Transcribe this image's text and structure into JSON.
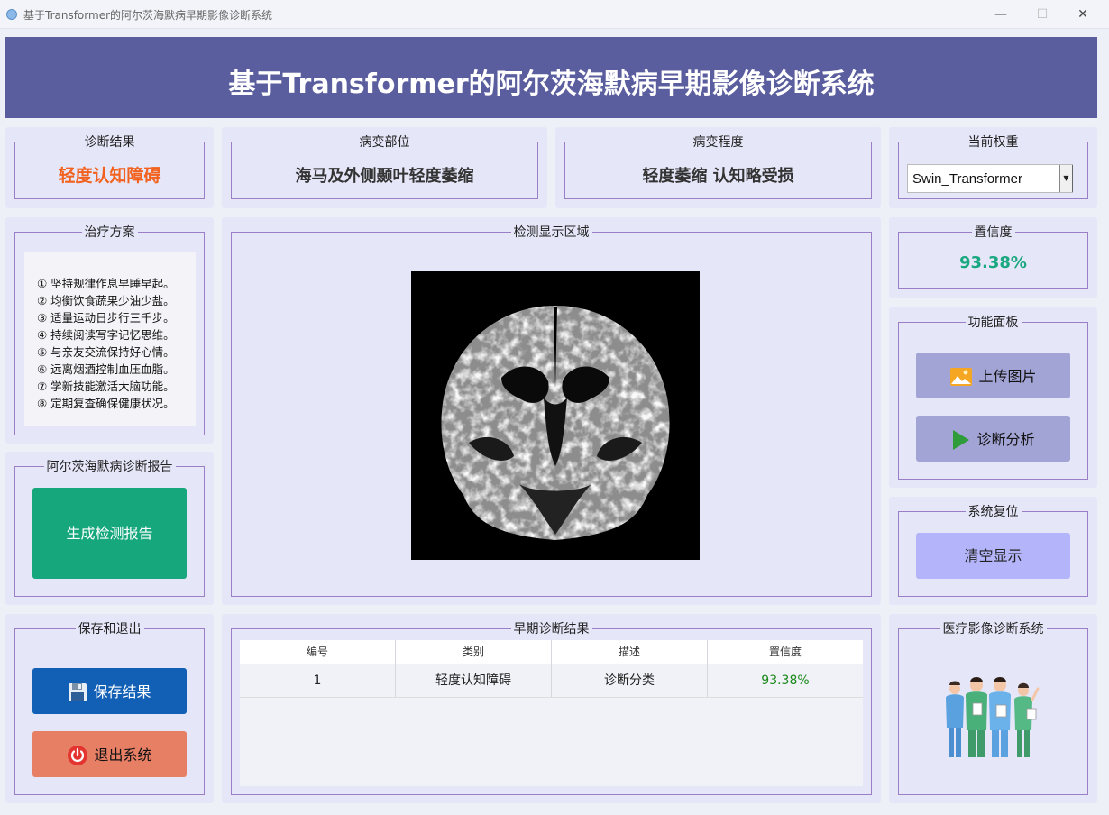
{
  "window": {
    "title": "基于Transformer的阿尔茨海默病早期影像诊断系统",
    "min": "—",
    "max": "☐",
    "close": "✕"
  },
  "header": {
    "title": "基于Transformer的阿尔茨海默病早期影像诊断系统"
  },
  "result": {
    "label": "诊断结果",
    "value": "轻度认知障碍",
    "color": "#f2611d"
  },
  "lesion_site": {
    "label": "病变部位",
    "value": "海马及外侧颞叶轻度萎缩"
  },
  "lesion_degree": {
    "label": "病变程度",
    "value": "轻度萎缩 认知略受损"
  },
  "weights": {
    "label": "当前权重",
    "selected": "Swin_Transformer"
  },
  "treatment": {
    "label": "治疗方案",
    "items": [
      "① 坚持规律作息早睡早起。",
      "② 均衡饮食蔬果少油少盐。",
      "③ 适量运动日步行三千步。",
      "④ 持续阅读写字记忆思维。",
      "⑤ 与亲友交流保持好心情。",
      "⑥ 远离烟酒控制血压血脂。",
      "⑦ 学新技能激活大脑功能。",
      "⑧ 定期复查确保健康状况。"
    ]
  },
  "display": {
    "label": "检测显示区域"
  },
  "confidence": {
    "label": "置信度",
    "value": "93.38%",
    "color": "#1aa880"
  },
  "functions": {
    "label": "功能面板",
    "upload": "上传图片",
    "analyze": "诊断分析"
  },
  "reset": {
    "label": "系统复位",
    "clear": "清空显示"
  },
  "report": {
    "label": "阿尔茨海默病诊断报告",
    "button": "生成检测报告"
  },
  "save_exit": {
    "label": "保存和退出",
    "save": "保存结果",
    "exit": "退出系统"
  },
  "early": {
    "label": "早期诊断结果",
    "columns": [
      "编号",
      "类别",
      "描述",
      "置信度"
    ],
    "rows": [
      [
        "1",
        "轻度认知障碍",
        "诊断分类",
        "93.38%"
      ]
    ],
    "confidence_color": "#1a8a1a"
  },
  "medical": {
    "label": "医疗影像诊断系统"
  },
  "colors": {
    "banner": "#5b5e9e",
    "card": "#e5e6f8",
    "group_border": "#9a7fc6",
    "report_button": "#16a77c",
    "save_button": "#1160b5",
    "exit_button": "#e77f65",
    "function_button": "#a3a4d6",
    "clear_button": "#b4b4fa"
  }
}
